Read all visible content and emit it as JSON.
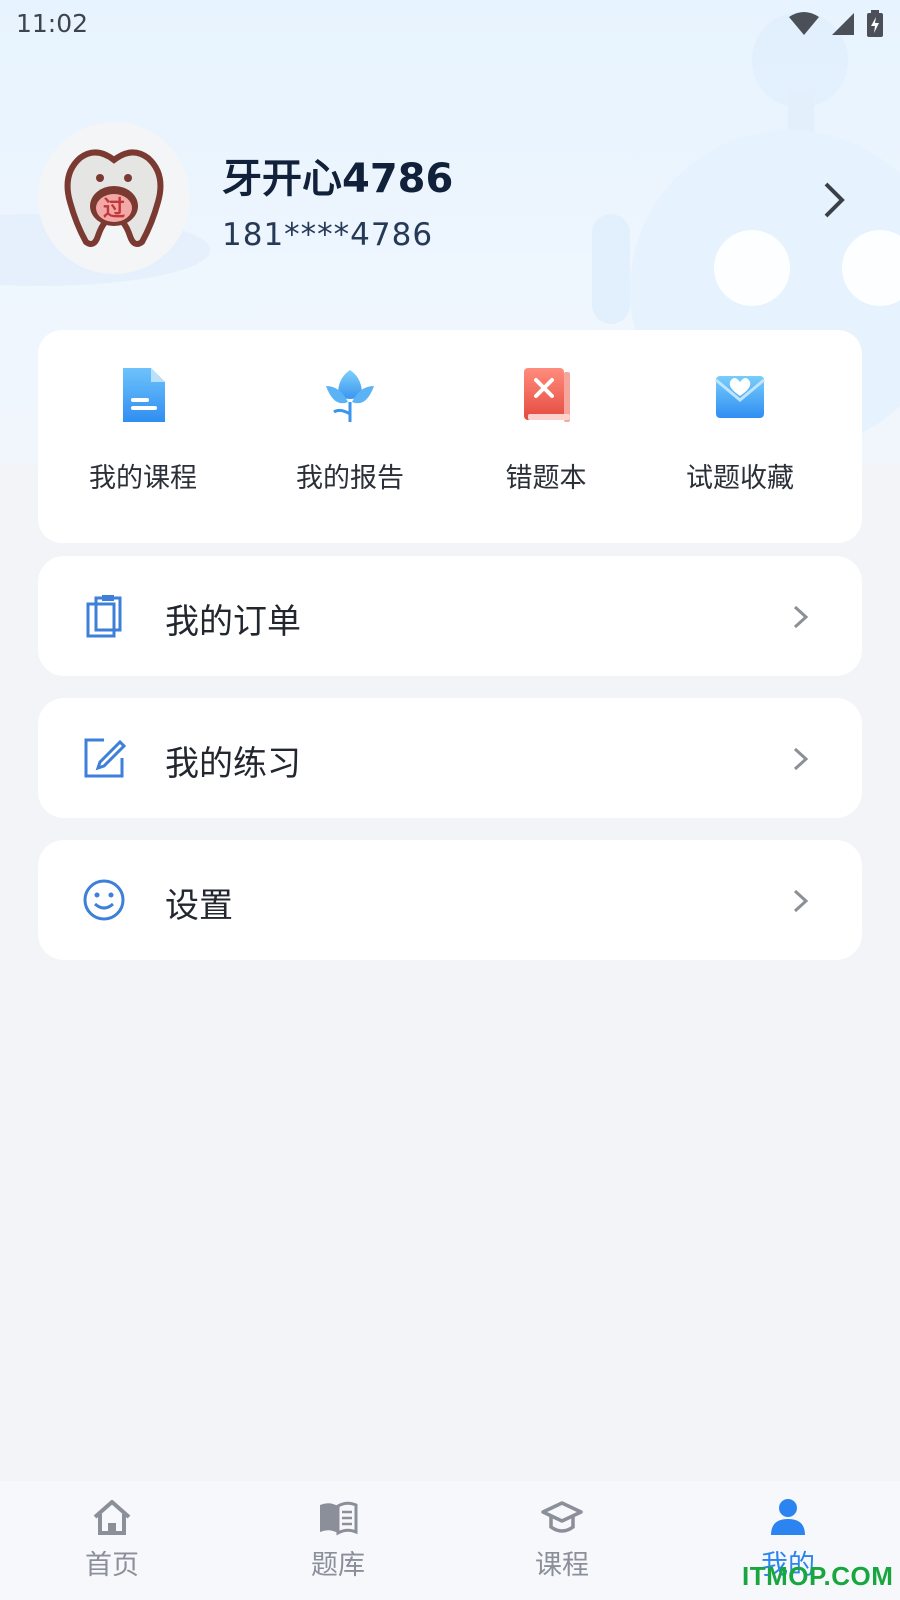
{
  "status_bar": {
    "time": "11:02"
  },
  "profile": {
    "name": "牙开心4786",
    "phone": "181****4786",
    "avatar_text": "过"
  },
  "quick_actions": [
    {
      "label": "我的课程",
      "icon": "document-icon"
    },
    {
      "label": "我的报告",
      "icon": "lotus-icon"
    },
    {
      "label": "错题本",
      "icon": "wrong-book-icon"
    },
    {
      "label": "试题收藏",
      "icon": "favorite-box-icon"
    }
  ],
  "menu": [
    {
      "label": "我的订单",
      "icon": "clipboard-icon"
    },
    {
      "label": "我的练习",
      "icon": "edit-icon"
    },
    {
      "label": "设置",
      "icon": "smiley-icon"
    }
  ],
  "tabs": [
    {
      "label": "首页",
      "icon": "home-icon"
    },
    {
      "label": "题库",
      "icon": "open-book-icon"
    },
    {
      "label": "课程",
      "icon": "graduation-cap-icon"
    },
    {
      "label": "我的",
      "icon": "person-icon",
      "active": true
    }
  ],
  "watermark": "ITMOP.COM",
  "colors": {
    "accent": "#2b84f0",
    "icon_blue": "#3d7fd9",
    "wrong_red": "#e9574c"
  }
}
